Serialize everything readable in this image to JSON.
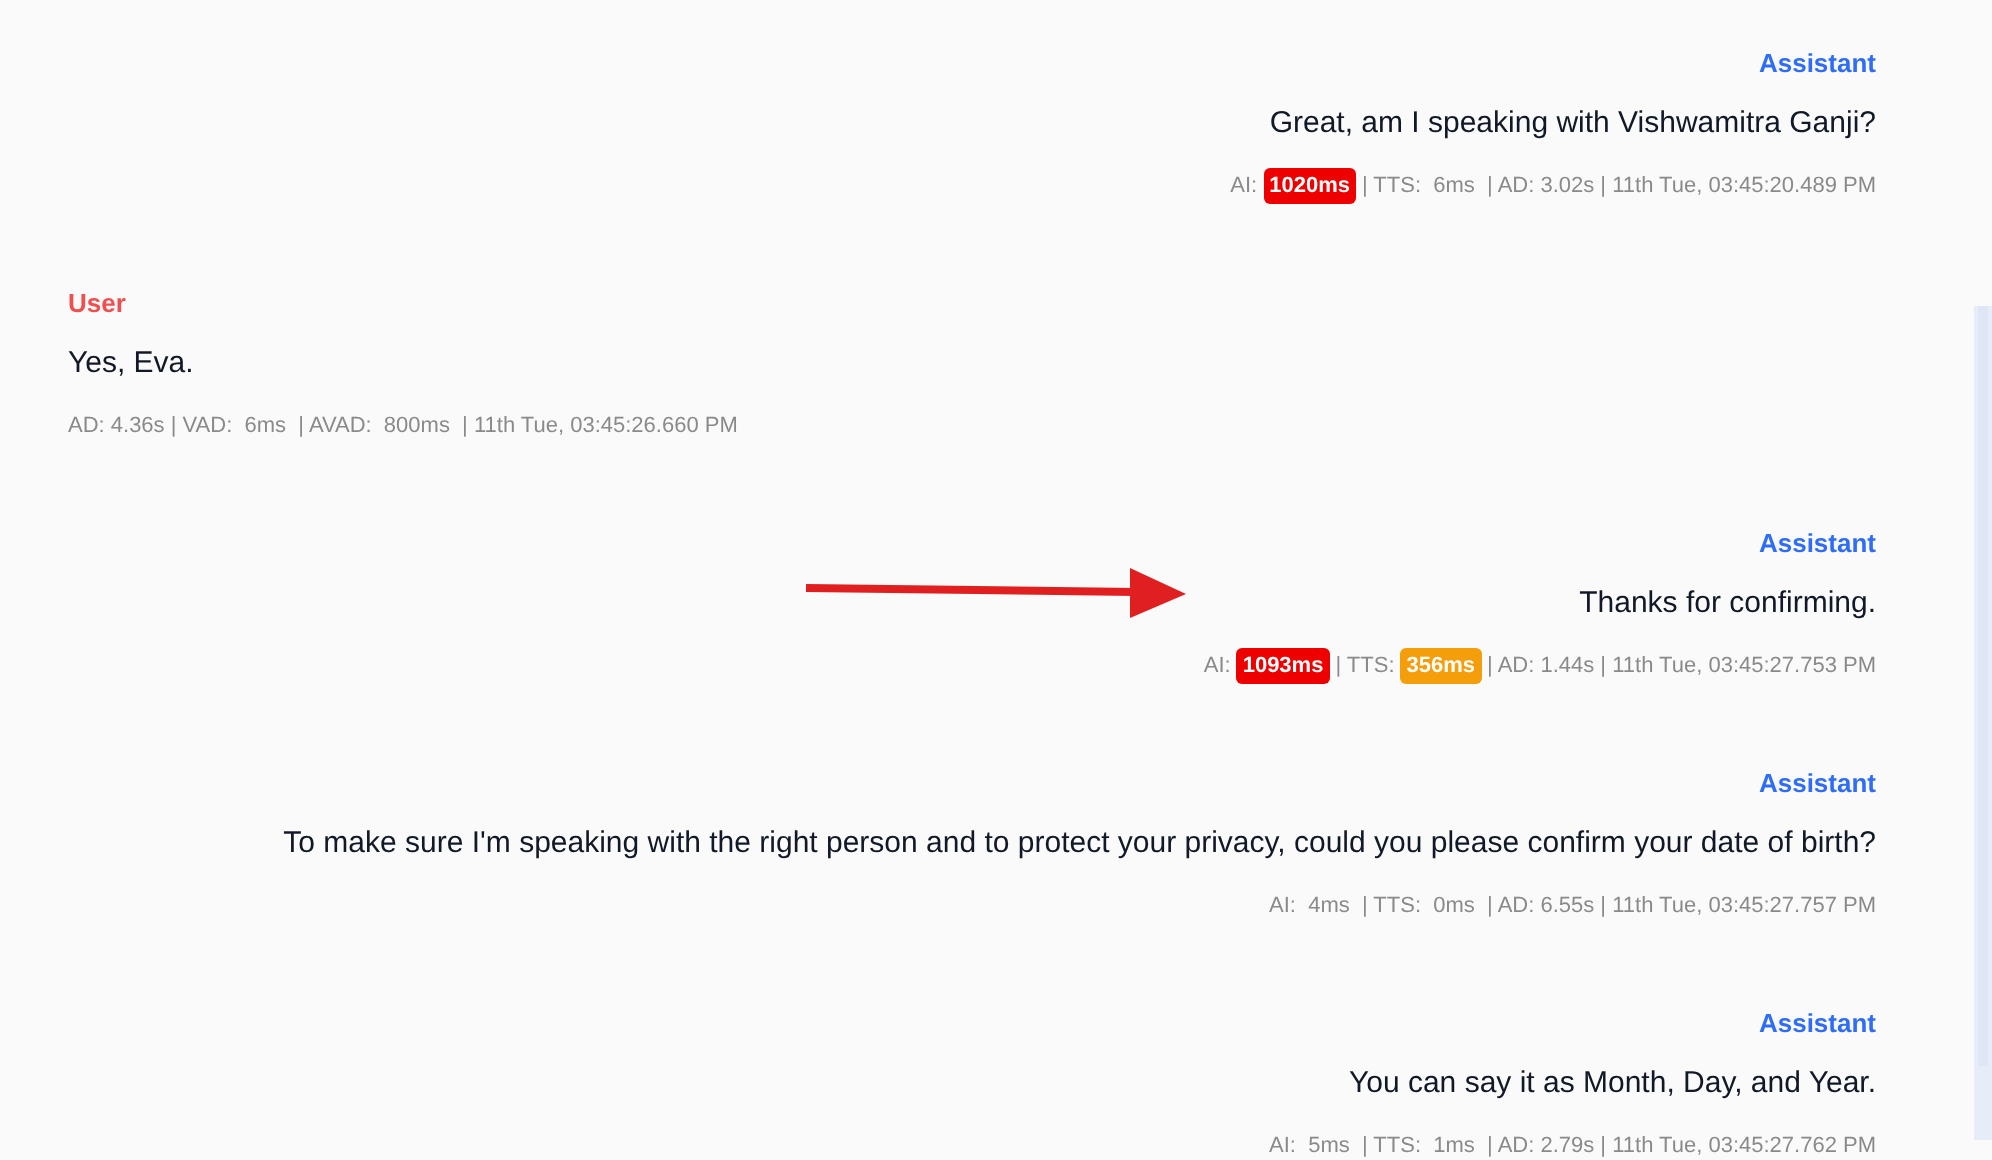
{
  "messages": [
    {
      "kind": "assistant",
      "speaker": "Assistant",
      "text": "Great, am I speaking with Vishwamitra Ganji?",
      "meta": [
        {
          "kind": "text",
          "text": "AI:"
        },
        {
          "kind": "badge",
          "text": "1020ms",
          "color": "#ef0000"
        },
        {
          "kind": "text",
          "text": "| TTS:  6ms  | AD: 3.02s | 11th Tue, 03:45:20.489 PM"
        }
      ]
    },
    {
      "kind": "user",
      "speaker": "User",
      "text": "Yes, Eva.",
      "meta": [
        {
          "kind": "text",
          "text": "AD: 4.36s | VAD:  6ms  | AVAD:  800ms  | 11th Tue, 03:45:26.660 PM"
        }
      ]
    },
    {
      "kind": "assistant",
      "speaker": "Assistant",
      "text": "Thanks for confirming.",
      "meta": [
        {
          "kind": "text",
          "text": "AI:"
        },
        {
          "kind": "badge",
          "text": "1093ms",
          "color": "#ef0000"
        },
        {
          "kind": "text",
          "text": "| TTS:"
        },
        {
          "kind": "badge",
          "text": "356ms",
          "color": "#f59e0b"
        },
        {
          "kind": "text",
          "text": "| AD: 1.44s | 11th Tue, 03:45:27.753 PM"
        }
      ]
    },
    {
      "kind": "assistant",
      "speaker": "Assistant",
      "text": "To make sure I'm speaking with the right person and to protect your privacy, could you please confirm your date of birth?",
      "meta": [
        {
          "kind": "text",
          "text": "AI:  4ms  | TTS:  0ms  | AD: 6.55s | 11th Tue, 03:45:27.757 PM"
        }
      ]
    },
    {
      "kind": "assistant",
      "speaker": "Assistant",
      "text": "You can say it as Month, Day, and Year.",
      "meta": [
        {
          "kind": "text",
          "text": "AI:  5ms  | TTS:  1ms  | AD: 2.79s | 11th Tue, 03:45:27.762 PM"
        }
      ]
    }
  ]
}
